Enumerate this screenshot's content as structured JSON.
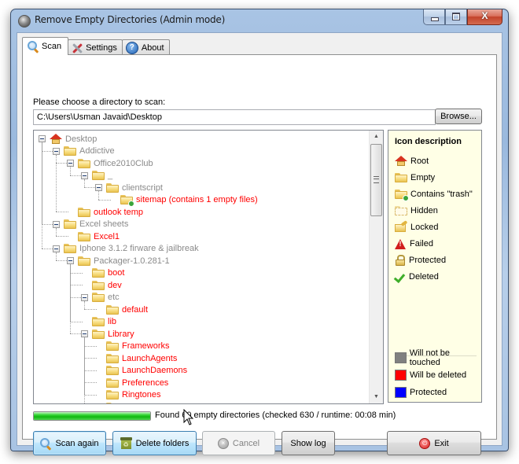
{
  "window": {
    "title": "Remove Empty Directories (Admin mode)",
    "caption_buttons": {
      "minimize": "minimize",
      "maximize": "maximize",
      "close": "X"
    }
  },
  "tabs": [
    {
      "label": "Scan",
      "icon": "magnifier-icon",
      "active": true
    },
    {
      "label": "Settings",
      "icon": "tools-icon",
      "active": false
    },
    {
      "label": "About",
      "icon": "info-icon",
      "active": false
    }
  ],
  "scan": {
    "directory_label": "Please choose a directory to scan:",
    "directory_value": "C:\\Users\\Usman Javaid\\Desktop",
    "browse_label": "Browse..."
  },
  "tree": {
    "nodes": [
      {
        "label": "Desktop",
        "depth": 0,
        "icon": "root",
        "status": "untouched",
        "expanded": true
      },
      {
        "label": "Addictive",
        "depth": 1,
        "icon": "folder",
        "status": "untouched",
        "expanded": true
      },
      {
        "label": "Office2010Club",
        "depth": 2,
        "icon": "folder",
        "status": "untouched",
        "expanded": true
      },
      {
        "label": "_",
        "depth": 3,
        "icon": "folder",
        "status": "untouched",
        "expanded": true
      },
      {
        "label": "clientscript",
        "depth": 4,
        "icon": "folder",
        "status": "untouched",
        "expanded": true
      },
      {
        "label": "sitemap (contains 1 empty files)",
        "depth": 5,
        "icon": "folder-trash",
        "status": "delete"
      },
      {
        "label": "outlook temp",
        "depth": 2,
        "icon": "folder",
        "status": "delete"
      },
      {
        "label": "Excel sheets",
        "depth": 1,
        "icon": "folder",
        "status": "untouched",
        "expanded": true
      },
      {
        "label": "Excel1",
        "depth": 2,
        "icon": "folder",
        "status": "delete"
      },
      {
        "label": "Iphone 3.1.2 firware & jailbreak",
        "depth": 1,
        "icon": "folder",
        "status": "untouched",
        "expanded": true
      },
      {
        "label": "Packager-1.0.281-1",
        "depth": 2,
        "icon": "folder",
        "status": "untouched",
        "expanded": true
      },
      {
        "label": "boot",
        "depth": 3,
        "icon": "folder",
        "status": "delete"
      },
      {
        "label": "dev",
        "depth": 3,
        "icon": "folder",
        "status": "delete"
      },
      {
        "label": "etc",
        "depth": 3,
        "icon": "folder",
        "status": "untouched",
        "expanded": true
      },
      {
        "label": "default",
        "depth": 4,
        "icon": "folder",
        "status": "delete"
      },
      {
        "label": "lib",
        "depth": 3,
        "icon": "folder",
        "status": "delete"
      },
      {
        "label": "Library",
        "depth": 3,
        "icon": "folder",
        "status": "delete",
        "expanded": true
      },
      {
        "label": "Frameworks",
        "depth": 4,
        "icon": "folder",
        "status": "delete"
      },
      {
        "label": "LaunchAgents",
        "depth": 4,
        "icon": "folder",
        "status": "delete"
      },
      {
        "label": "LaunchDaemons",
        "depth": 4,
        "icon": "folder",
        "status": "delete"
      },
      {
        "label": "Preferences",
        "depth": 4,
        "icon": "folder",
        "status": "delete"
      },
      {
        "label": "Ringtones",
        "depth": 4,
        "icon": "folder",
        "status": "delete"
      },
      {
        "label": "Wall...",
        "depth": 4,
        "icon": "folder",
        "status": "delete"
      }
    ]
  },
  "legend": {
    "title": "Icon description",
    "icons": [
      {
        "label": "Root",
        "icon": "root-icon"
      },
      {
        "label": "Empty",
        "icon": "empty-folder-icon"
      },
      {
        "label": "Contains \"trash\"",
        "icon": "trash-folder-icon"
      },
      {
        "label": "Hidden",
        "icon": "hidden-folder-icon"
      },
      {
        "label": "Locked",
        "icon": "locked-folder-icon"
      },
      {
        "label": "Failed",
        "icon": "warning-icon"
      },
      {
        "label": "Protected",
        "icon": "lock-icon"
      },
      {
        "label": "Deleted",
        "icon": "checkmark-icon"
      }
    ],
    "colors": [
      {
        "label": "Will not be touched",
        "color": "#808080"
      },
      {
        "label": "Will be deleted",
        "color": "#ff0000"
      },
      {
        "label": "Protected",
        "color": "#0000ff"
      }
    ]
  },
  "status": {
    "progress_percent": 100,
    "text": "Found 60 empty directories (checked 630 / runtime: 00:08 min)",
    "progress_color": "#1cc41c"
  },
  "buttons": {
    "scan_again": "Scan again",
    "delete_folders": "Delete folders",
    "cancel": "Cancel",
    "show_log": "Show log",
    "exit": "Exit"
  }
}
